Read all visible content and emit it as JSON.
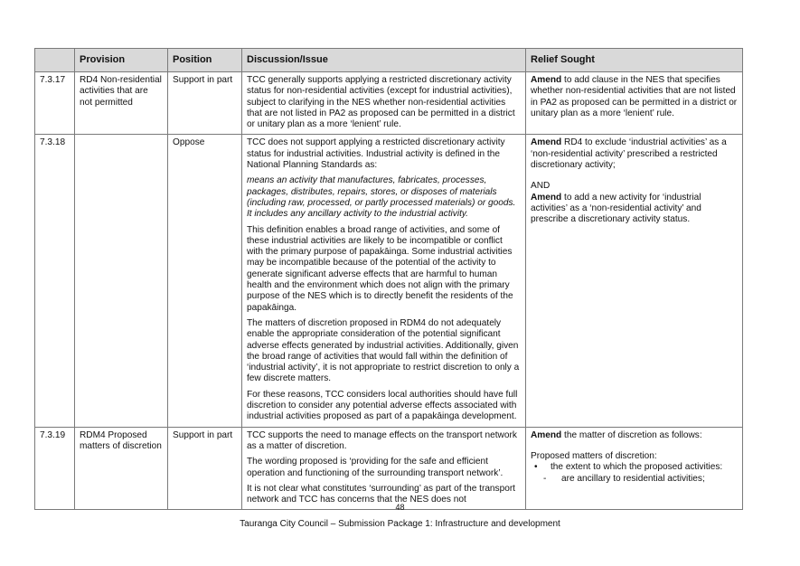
{
  "table": {
    "headers": [
      "",
      "Provision",
      "Position",
      "Discussion/Issue",
      "Relief Sought"
    ],
    "rows": [
      {
        "ref": "7.3.17",
        "provision": "RD4 Non-residential activities that are not permitted",
        "position": "Support in part",
        "discussion": [
          "TCC generally supports applying a restricted discretionary activity status for non-residential activities (except for industrial activities), subject to clarifying in the NES whether non-residential activities that are not listed in PA2 as proposed can be permitted in a district or unitary plan as a more ‘lenient’ rule."
        ],
        "relief": {
          "bold": "Amend",
          "text": " to add clause in the NES that specifies whether non-residential activities that are not listed in PA2 as proposed can be permitted in a district or unitary plan as a more ‘lenient’ rule."
        }
      },
      {
        "ref": "7.3.18",
        "provision": "",
        "position": "Oppose",
        "discussion": [
          "TCC does not support applying a restricted discretionary activity status for industrial activities. Industrial activity is defined in the National Planning Standards as:",
          "means an activity that manufactures, fabricates, processes, packages, distributes, repairs, stores, or disposes of materials (including raw, processed, or partly processed materials) or goods. It includes any ancillary activity to the industrial activity.",
          "This definition enables a broad range of activities, and some of these industrial activities are likely to be incompatible or conflict with the primary purpose of papakāinga. Some industrial activities may be incompatible because of the potential of the activity to generate significant adverse effects that are harmful to human health and the environment which does not align with the primary purpose of the NES which is to directly benefit the residents of the papakāinga.",
          "The matters of discretion proposed in RDM4 do not adequately enable the appropriate consideration of the potential significant adverse effects generated by industrial activities. Additionally, given the broad range of activities that would fall within the definition of ‘industrial activity’, it is not appropriate to restrict discretion to only a few discrete matters.",
          "For these reasons, TCC considers local authorities should have full discretion to consider any potential adverse effects associated with industrial activities proposed as part of a papakāinga development."
        ],
        "relief": {
          "bold1": "Amend",
          "text1": " RD4 to exclude ‘industrial activities’ as a ‘non-residential activity’ prescribed a restricted discretionary activity;",
          "and": "AND",
          "bold2": "Amend",
          "text2": " to add a new activity for ‘industrial activities’ as a ‘non-residential activity’ and prescribe a discretionary activity status."
        }
      },
      {
        "ref": "7.3.19",
        "provision": "RDM4 Proposed matters of discretion",
        "position": "Support in part",
        "discussion": [
          "TCC supports the need to manage effects on the transport network as a matter of discretion.",
          "The wording proposed is ‘providing for the safe and efficient operation and functioning of the surrounding transport network’.",
          "It is not clear what constitutes ‘surrounding’ as part of the transport network and TCC has concerns that the NES does not"
        ],
        "relief": {
          "bold": "Amend",
          "text": " the matter of discretion as follows:",
          "sub": "Proposed matters of discretion:",
          "bullet": "the extent to which the proposed activities:",
          "dash": "are ancillary to residential activities;"
        }
      }
    ]
  },
  "page_number": "48",
  "footer": "Tauranga City Council – Submission Package 1: Infrastructure and development"
}
